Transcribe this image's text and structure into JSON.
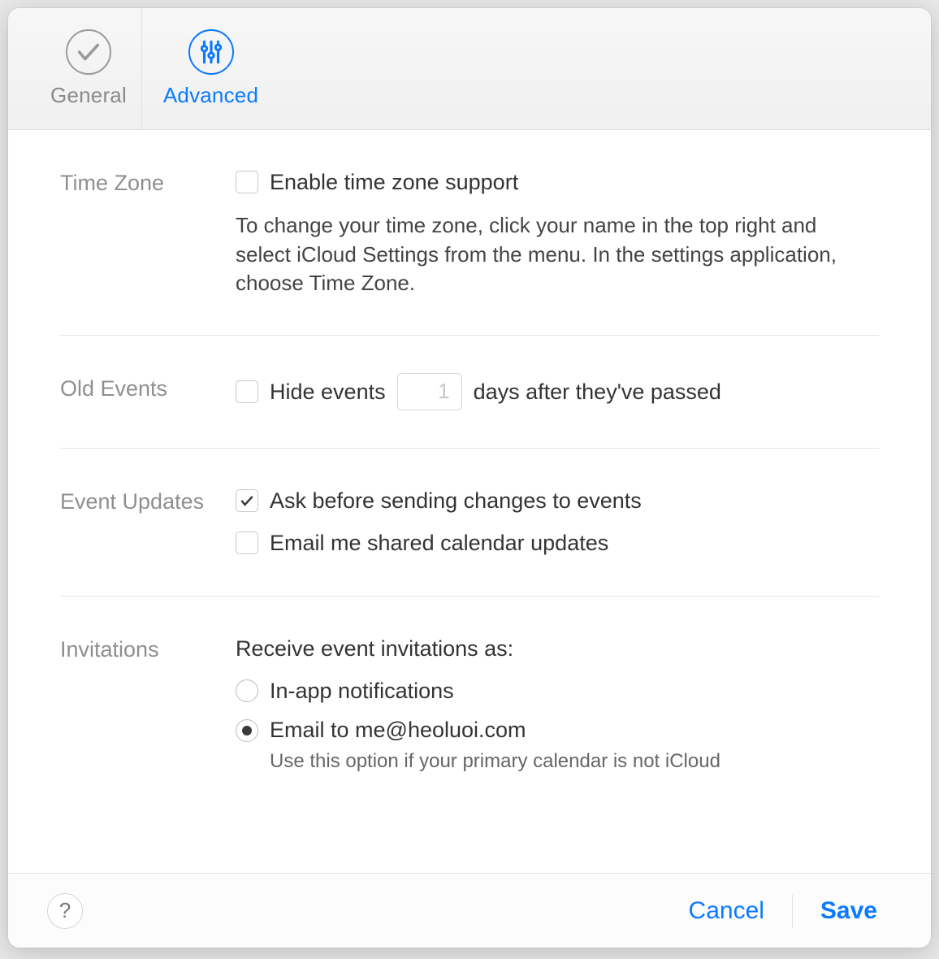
{
  "tabs": {
    "general": "General",
    "advanced": "Advanced"
  },
  "sections": {
    "timezone": {
      "heading": "Time Zone",
      "checkbox_label": "Enable time zone support",
      "help": "To change your time zone, click your name in the top right and select iCloud Settings from the menu. In the settings application, choose Time Zone."
    },
    "old_events": {
      "heading": "Old Events",
      "prefix": "Hide events",
      "value": "1",
      "suffix": "days after they've passed"
    },
    "event_updates": {
      "heading": "Event Updates",
      "ask_label": "Ask before sending changes to events",
      "email_label": "Email me shared calendar updates"
    },
    "invitations": {
      "heading": "Invitations",
      "intro": "Receive event invitations as:",
      "inapp": "In-app notifications",
      "email": "Email to me@heoluoi.com",
      "email_note": "Use this option if your primary calendar is not iCloud"
    }
  },
  "footer": {
    "help": "?",
    "cancel": "Cancel",
    "save": "Save"
  }
}
